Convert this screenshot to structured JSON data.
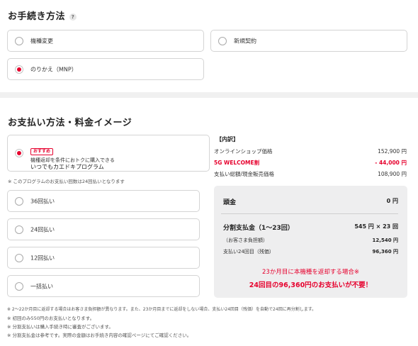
{
  "procedure": {
    "title": "お手続き方法",
    "help_icon": "?",
    "options": [
      {
        "label": "機種変更",
        "selected": false
      },
      {
        "label": "新規契約",
        "selected": false
      },
      {
        "label": "のりかえ（MNP）",
        "selected": true
      }
    ]
  },
  "payment": {
    "title": "お支払い方法・料金イメージ",
    "program": {
      "badge": "おすすめ",
      "line1": "機種返却を条件におトクに購入できる",
      "line2": "いつでもカエドキプログラム",
      "selected": true
    },
    "program_note": "※ このプログラムのお支払い回数は24回払いとなります",
    "options": [
      {
        "label": "36回払い",
        "selected": false
      },
      {
        "label": "24回払い",
        "selected": false
      },
      {
        "label": "12回払い",
        "selected": false
      },
      {
        "label": "一括払い",
        "selected": false
      }
    ]
  },
  "breakdown": {
    "title": "【内訳】",
    "rows": [
      {
        "label": "オンラインショップ価格",
        "value": "152,900 円"
      },
      {
        "label": "5G WELCOME割",
        "value": "- 44,000 円",
        "highlight": true
      },
      {
        "label": "支払い総額/現金販売価格",
        "value": "108,900 円"
      }
    ]
  },
  "summary": {
    "down_payment_label": "頭金",
    "down_payment_value": "0 円",
    "installment_label": "分割支払金（1〜23回）",
    "installment_value": "545 円 × 23 回",
    "customer_label": "（お客さま負担額）",
    "customer_value": "12,540 円",
    "final_label": "支払い24回目（残価）",
    "final_value": "96,360 円",
    "promo_line1": "23か月目に本機種を返却する場合※",
    "promo_line2": "24回目の96,360円のお支払いが不要！"
  },
  "notes": [
    "※ 2〜22か月目に返却する場合はお客さま負担額が異なります。また、23か月目までに返却をしない場合、支払い24回目（残価）を自動で24回に再分割します。",
    "※ 初回のみ550円のお支払いとなります。",
    "※ 分割支払いは購入手続き時に審査がございます。",
    "※ 分割支払金は参考です。実際の金額はお手続き内容の確認ページにてご確認ください。"
  ],
  "colors": {
    "accent": "#e6002d",
    "summary_bg": "#eeeeef",
    "border": "#d4d4d4"
  }
}
